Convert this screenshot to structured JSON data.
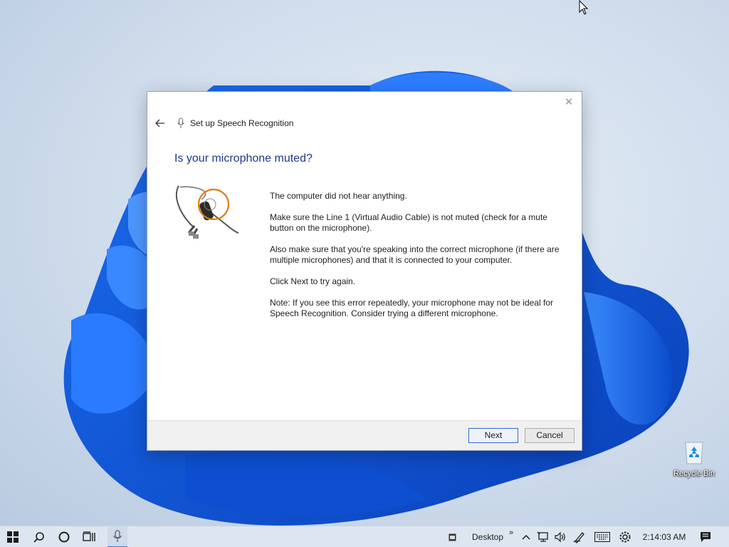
{
  "dialog": {
    "title": "Set up Speech Recognition",
    "heading": "Is your microphone muted?",
    "paragraphs": [
      "The computer did not hear anything.",
      "Make sure the Line 1 (Virtual Audio Cable) is not muted (check for a mute button on the microphone).",
      "Also make sure that you're speaking into the correct microphone (if there are multiple microphones) and that it is connected to your computer.",
      "Click Next to try again.",
      "Note: If you see this error repeatedly, your microphone may not be ideal for Speech Recognition. Consider trying a different microphone."
    ],
    "next_label": "Next",
    "cancel_label": "Cancel",
    "close_glyph": "✕"
  },
  "desktop": {
    "recycle_bin_label": "Recycle Bin"
  },
  "taskbar": {
    "desktop_label": "Desktop",
    "chevron": "»",
    "clock": "2:14:03 AM"
  },
  "icons": {
    "start": "windows-start-icon",
    "search": "search-icon",
    "cortana": "cortana-circle-icon",
    "task_view": "task-view-icon",
    "speech": "microphone-icon",
    "notification": "notification-icon"
  },
  "colors": {
    "heading": "#1c3a8a",
    "accent": "#2e6bd1",
    "highlight_ring": "#e07a10"
  }
}
